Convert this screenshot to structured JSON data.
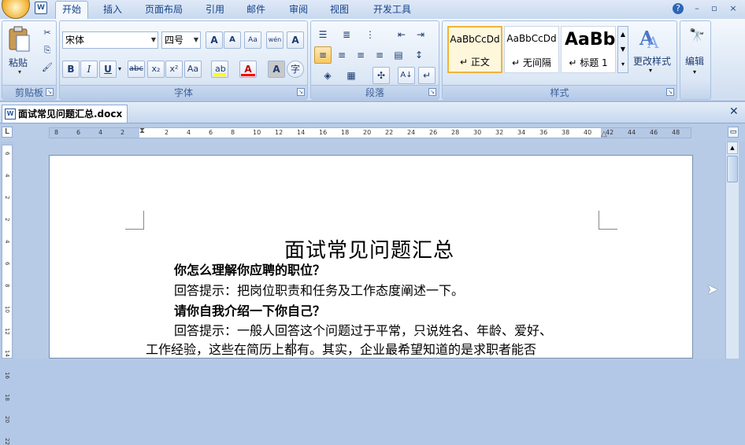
{
  "tabs": [
    "开始",
    "插入",
    "页面布局",
    "引用",
    "邮件",
    "审阅",
    "视图",
    "开发工具"
  ],
  "quick_access_icon": "word-icon",
  "window_controls": [
    "?",
    "–",
    "▫",
    "×"
  ],
  "clipboard": {
    "paste_label": "粘贴",
    "group_label": "剪贴板"
  },
  "font": {
    "name": "宋体",
    "size": "四号",
    "group_label": "字体",
    "bold": "B",
    "italic": "I",
    "underline": "U",
    "strike": "abc",
    "sub": "x₂",
    "sup": "x²",
    "case": "Aa",
    "color_a": "A",
    "grow": "A",
    "shrink": "A",
    "phonetic": "wén",
    "border_char": "A",
    "char_shading": "A",
    "enclose": "字"
  },
  "paragraph": {
    "group_label": "段落"
  },
  "styles": {
    "group_label": "样式",
    "items": [
      {
        "sample": "AaBbCcDd",
        "name": "正文"
      },
      {
        "sample": "AaBbCcDd",
        "name": "无间隔"
      },
      {
        "sample": "AaBb",
        "name": "标题 1"
      }
    ],
    "change_label": "更改样式"
  },
  "editing": {
    "label": "编辑"
  },
  "document": {
    "tab_title": "面试常见问题汇总.docx",
    "title": "面试常见问题汇总",
    "lines": [
      {
        "text": "你怎么理解你应聘的职位？",
        "bold": true
      },
      {
        "text": "回答提示：把岗位职责和任务及工作态度阐述一下。",
        "bold": false
      },
      {
        "text": "请你自我介绍一下你自己？",
        "bold": true
      },
      {
        "text": "回答提示：一般人回答这个问题过于平常，只说姓名、年龄、爱好、",
        "bold": false
      },
      {
        "text": "工作经验，这些在简历上都有。其实，企业最希望知道的是求职者能否",
        "bold": false
      }
    ]
  },
  "ruler": {
    "ticks": [
      "8",
      "6",
      "4",
      "2",
      "2",
      "4",
      "6",
      "8",
      "10",
      "12",
      "14",
      "16",
      "18",
      "20",
      "22",
      "24",
      "26",
      "28",
      "30",
      "32",
      "34",
      "36",
      "38",
      "40",
      "42",
      "44",
      "46",
      "48"
    ]
  },
  "vruler": {
    "ticks": [
      "6",
      "4",
      "2",
      "2",
      "4",
      "6",
      "8",
      "10",
      "12",
      "14",
      "16",
      "18",
      "20",
      "22"
    ]
  }
}
